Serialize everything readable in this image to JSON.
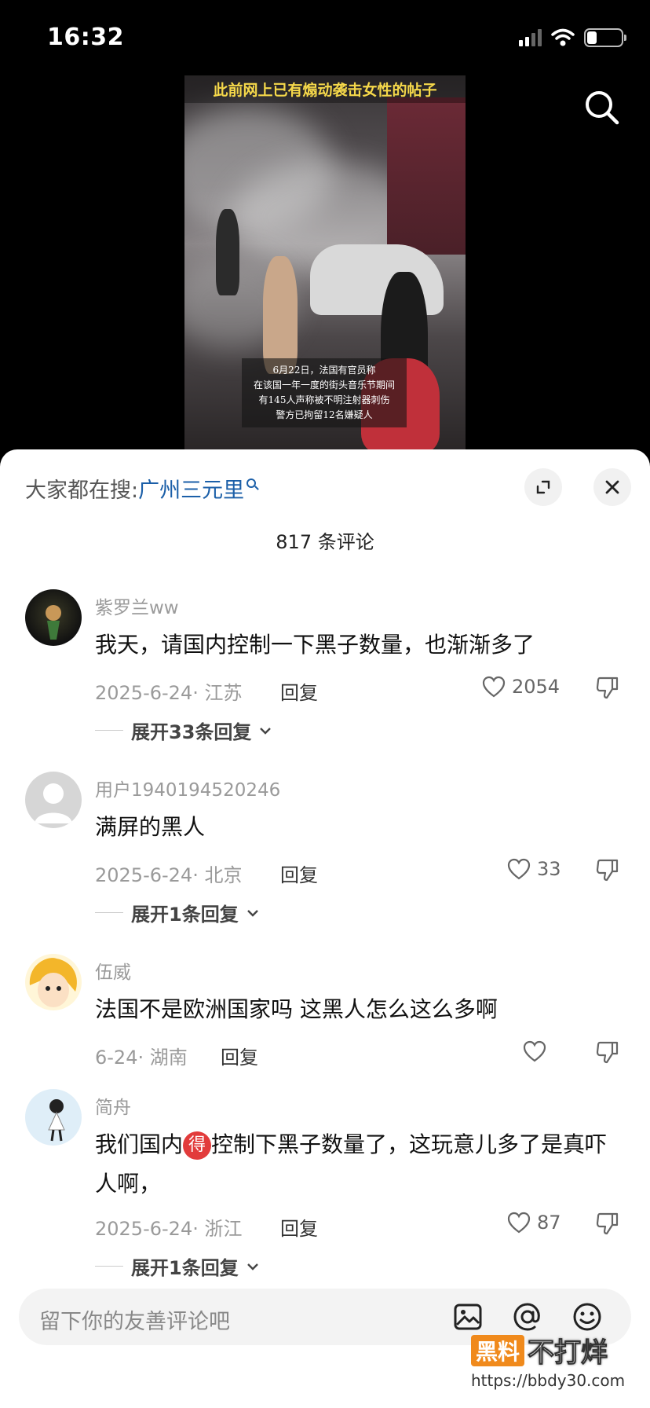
{
  "status": {
    "time": "16:32"
  },
  "video": {
    "top_caption": "此前网上已有煽动袭击女性的帖子",
    "caption_lines": [
      "6月22日，法国有官员称",
      "在该国一年一度的街头音乐节期间",
      "有145人声称被不明注射器刺伤",
      "警方已拘留12名嫌疑人"
    ]
  },
  "sheet": {
    "hot_search_prefix": "大家都在搜:",
    "hot_search_keyword": "广州三元里",
    "comment_count_title": "817 条评论"
  },
  "comments": [
    {
      "name": "紫罗兰ww",
      "text": "我天，请国内控制一下黑子数量，也渐渐多了",
      "meta": "2025-6-24· 江苏",
      "reply": "回复",
      "likes": "2054",
      "expand": "展开33条回复"
    },
    {
      "name": "用户1940194520246",
      "text": "满屏的黑人",
      "meta": "2025-6-24· 北京",
      "reply": "回复",
      "likes": "33",
      "expand": "展开1条回复"
    },
    {
      "name": "伍威",
      "text": "法国不是欧洲国家吗 这黑人怎么这么多啊",
      "meta": "6-24· 湖南",
      "reply": "回复",
      "likes": ""
    },
    {
      "name": "简舟",
      "text_before": "我们国内",
      "badge": "得",
      "text_after": "控制下黑子数量了，这玩意儿多了是真吓人啊，",
      "meta": "2025-6-24· 浙江",
      "reply": "回复",
      "likes": "87",
      "expand": "展开1条回复"
    }
  ],
  "input": {
    "placeholder": "留下你的友善评论吧"
  },
  "watermark": {
    "box": "黑料",
    "text": "不打烊",
    "url": "https://bbdy30.com"
  }
}
